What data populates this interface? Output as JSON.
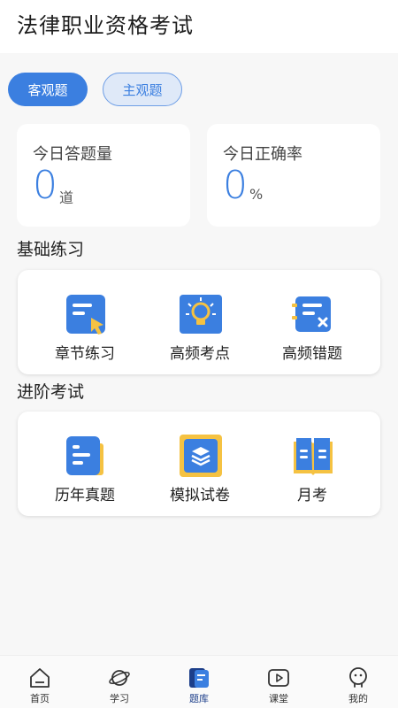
{
  "header": {
    "title": "法律职业资格考试"
  },
  "segments": {
    "objective": "客观题",
    "subjective": "主观题"
  },
  "stats": [
    {
      "label": "今日答题量",
      "value": "0",
      "unit": "道"
    },
    {
      "label": "今日正确率",
      "value": "0",
      "unit": "%"
    }
  ],
  "sections": {
    "basic": {
      "title": "基础练习",
      "items": [
        {
          "label": "章节练习",
          "icon": "chapter-practice-icon"
        },
        {
          "label": "高频考点",
          "icon": "lightbulb-icon"
        },
        {
          "label": "高频错题",
          "icon": "wrong-questions-icon"
        }
      ]
    },
    "advanced": {
      "title": "进阶考试",
      "items": [
        {
          "label": "历年真题",
          "icon": "past-papers-icon"
        },
        {
          "label": "模拟试卷",
          "icon": "mock-exam-icon"
        },
        {
          "label": "月考",
          "icon": "open-book-icon"
        }
      ]
    }
  },
  "tabbar": [
    {
      "label": "首页",
      "icon": "home-icon"
    },
    {
      "label": "学习",
      "icon": "planet-icon"
    },
    {
      "label": "题库",
      "icon": "question-bank-icon",
      "active": true
    },
    {
      "label": "课堂",
      "icon": "play-icon"
    },
    {
      "label": "我的",
      "icon": "profile-icon"
    }
  ],
  "colors": {
    "accent": "#3b7fe0",
    "accent_light": "#dfe9f8",
    "icon_yellow": "#f5c242",
    "active_tab": "#1d3f8a"
  }
}
